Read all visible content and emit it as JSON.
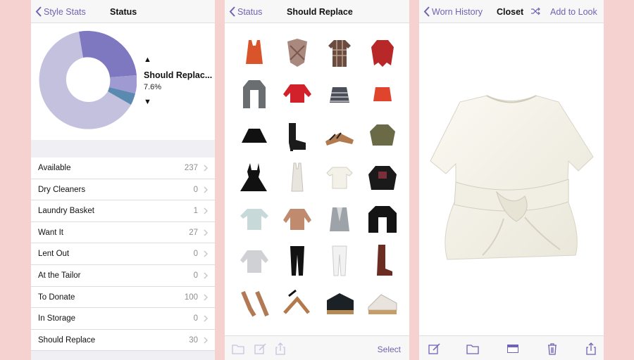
{
  "colors": {
    "accent": "#6e63b4",
    "background": "#f5d2cf",
    "donut_available": "#c3c1de",
    "donut_want": "#7e78c1",
    "donut_donate": "#9f9bd2",
    "donut_replace": "#5b8ab0"
  },
  "screen1": {
    "nav": {
      "back_label": "Style Stats",
      "title": "Status"
    },
    "legend": {
      "up_arrow": "▲",
      "down_arrow": "▼",
      "name": "Should Replac...",
      "percent": "7.6%"
    },
    "rows": [
      {
        "label": "Available",
        "count": "237"
      },
      {
        "label": "Dry Cleaners",
        "count": "0"
      },
      {
        "label": "Laundry Basket",
        "count": "1"
      },
      {
        "label": "Want It",
        "count": "27"
      },
      {
        "label": "Lent Out",
        "count": "0"
      },
      {
        "label": "At the Tailor",
        "count": "0"
      },
      {
        "label": "To Donate",
        "count": "100"
      },
      {
        "label": "In Storage",
        "count": "0"
      },
      {
        "label": "Should Replace",
        "count": "30"
      }
    ]
  },
  "screen2": {
    "nav": {
      "back_label": "Status",
      "title": "Should Replace"
    },
    "items": [
      "orange-tank-top",
      "plaid-wrap",
      "plaid-shirt",
      "red-jacket",
      "grey-long-cardigan",
      "red-sweater",
      "striped-mini-skirt",
      "red-mini-skirt",
      "black-skater-skirt",
      "black-ankle-boots",
      "tan-sandals",
      "olive-jacket",
      "black-dress",
      "white-tank-top",
      "white-tie-top",
      "black-embellished-jacket",
      "mint-blouse",
      "tan-sweater",
      "grey-vest",
      "black-cardigan",
      "grey-knit-top",
      "black-jeans",
      "white-jeans",
      "brown-tall-boots",
      "tan-heeled-sandals",
      "tan-lace-up-heels",
      "black-wedge-booties",
      "white-wedge-sandals"
    ],
    "toolbar": {
      "select_label": "Select"
    }
  },
  "screen3": {
    "nav": {
      "back_label": "Worn History",
      "title": "Closet",
      "add_label": "Add to Look"
    },
    "item": "white-tie-front-top"
  }
}
